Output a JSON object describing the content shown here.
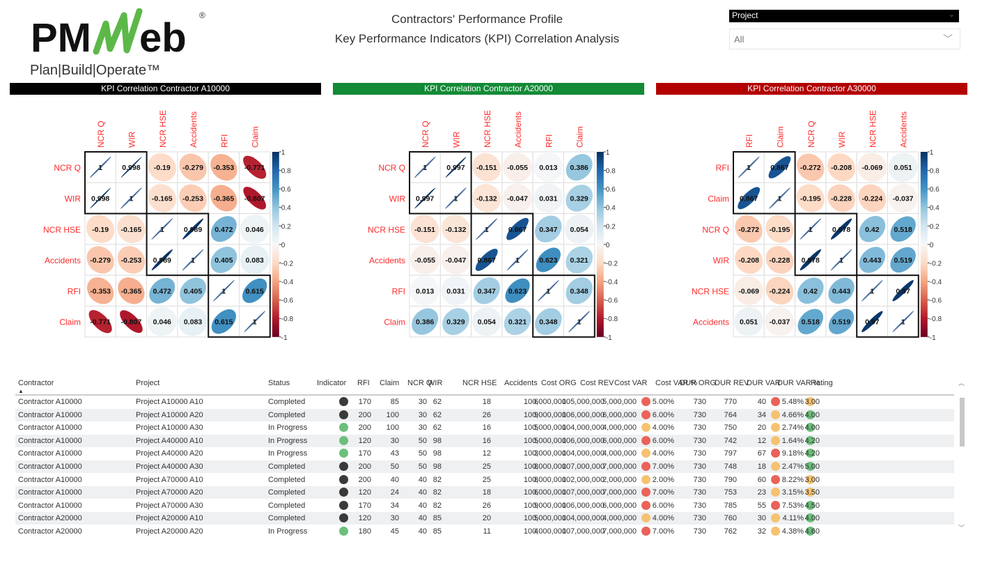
{
  "logo": {
    "text": "PMWeb",
    "tagline": "Plan|Build|Operate™",
    "registered": "®"
  },
  "header": {
    "title_line1": "Contractors' Performance Profile",
    "title_line2": "Key Performance Indicators (KPI) Correlation Analysis"
  },
  "filter": {
    "label": "Project",
    "value": "All"
  },
  "colorbar_ticks": [
    "1",
    "0.8",
    "0.6",
    "0.4",
    "0.2",
    "0",
    "-0.2",
    "-0.4",
    "-0.6",
    "-0.8",
    "-1"
  ],
  "colors": {
    "black_header": "#000000",
    "green_header": "#138a36",
    "red_header": "#b30000",
    "label_red": "#ff2b2b"
  },
  "matrices": [
    {
      "title": "KPI Correlation Contractor A10000",
      "header_color": "#000000",
      "labels": [
        "NCR Q",
        "WIR",
        "NCR HSE",
        "Accidents",
        "RFI",
        "Claim"
      ],
      "values": [
        [
          1,
          0.998,
          -0.19,
          -0.279,
          -0.353,
          -0.771
        ],
        [
          0.998,
          1,
          -0.165,
          -0.253,
          -0.365,
          -0.807
        ],
        [
          -0.19,
          -0.165,
          1,
          0.989,
          0.472,
          0.046
        ],
        [
          -0.279,
          -0.253,
          0.989,
          1,
          0.405,
          0.083
        ],
        [
          -0.353,
          -0.365,
          0.472,
          0.405,
          1,
          0.615
        ],
        [
          -0.771,
          -0.807,
          0.046,
          0.083,
          0.615,
          1
        ]
      ]
    },
    {
      "title": "KPI Correlation Contractor A20000",
      "header_color": "#138a36",
      "labels": [
        "NCR Q",
        "WIR",
        "NCR HSE",
        "Accidents",
        "RFI",
        "Claim"
      ],
      "values": [
        [
          1,
          0.997,
          -0.151,
          -0.055,
          0.013,
          0.386
        ],
        [
          0.997,
          1,
          -0.132,
          -0.047,
          0.031,
          0.329
        ],
        [
          -0.151,
          -0.132,
          1,
          0.867,
          0.347,
          0.054
        ],
        [
          -0.055,
          -0.047,
          0.867,
          1,
          0.623,
          0.321
        ],
        [
          0.013,
          0.031,
          0.347,
          0.623,
          1,
          0.348
        ],
        [
          0.386,
          0.329,
          0.054,
          0.321,
          0.348,
          1
        ]
      ]
    },
    {
      "title": "KPI Correlation Contractor A30000",
      "header_color": "#b30000",
      "labels": [
        "RFI",
        "Claim",
        "NCR Q",
        "WIR",
        "NCR HSE",
        "Accidents"
      ],
      "values": [
        [
          1,
          0.867,
          -0.272,
          -0.208,
          -0.069,
          0.051
        ],
        [
          0.867,
          1,
          -0.195,
          -0.228,
          -0.224,
          -0.037
        ],
        [
          -0.272,
          -0.195,
          1,
          0.978,
          0.42,
          0.518
        ],
        [
          -0.208,
          -0.228,
          0.978,
          1,
          0.443,
          0.519
        ],
        [
          -0.069,
          -0.224,
          0.42,
          0.443,
          1,
          0.97
        ],
        [
          0.051,
          -0.037,
          0.518,
          0.519,
          0.97,
          1
        ]
      ]
    }
  ],
  "table": {
    "columns": [
      "Contractor",
      "Project",
      "Status",
      "Indicator",
      "RFI",
      "Claim",
      "NCR Q",
      "WIR",
      "NCR HSE",
      "Accidents",
      "Cost ORG",
      "Cost REV",
      "Cost VAR",
      "Cost VAR %",
      "DUR ORG",
      "DUR REV",
      "DUR VAR",
      "DUR VAR %",
      "Rating"
    ],
    "sort_indicator": "▲",
    "rows": [
      [
        "Contractor A10000",
        "Project A10000 A10",
        "Completed",
        "dark",
        "170",
        "85",
        "30",
        "62",
        "18",
        "6",
        "100,000,000",
        "105,000,000",
        "5,000,000",
        "red",
        "5.00%",
        "730",
        "770",
        "40",
        "red",
        "5.48%",
        "orange",
        "3.00"
      ],
      [
        "Contractor A10000",
        "Project A10000 A20",
        "Completed",
        "dark",
        "200",
        "100",
        "30",
        "62",
        "26",
        "9",
        "100,000,000",
        "106,000,000",
        "6,000,000",
        "red",
        "6.00%",
        "730",
        "764",
        "34",
        "orange",
        "4.66%",
        "green",
        "4.00"
      ],
      [
        "Contractor A10000",
        "Project A10000 A30",
        "In Progress",
        "green",
        "200",
        "100",
        "30",
        "62",
        "16",
        "5",
        "100,000,000",
        "104,000,000",
        "4,000,000",
        "orange",
        "4.00%",
        "730",
        "750",
        "20",
        "orange",
        "2.74%",
        "green",
        "4.00"
      ],
      [
        "Contractor A10000",
        "Project A40000 A10",
        "In Progress",
        "green",
        "120",
        "30",
        "50",
        "98",
        "16",
        "5",
        "100,000,000",
        "106,000,000",
        "6,000,000",
        "red",
        "6.00%",
        "730",
        "742",
        "12",
        "orange",
        "1.64%",
        "green",
        "4.20"
      ],
      [
        "Contractor A10000",
        "Project A40000 A20",
        "In Progress",
        "green",
        "170",
        "43",
        "50",
        "98",
        "12",
        "3",
        "100,000,000",
        "104,000,000",
        "4,000,000",
        "orange",
        "4.00%",
        "730",
        "797",
        "67",
        "red",
        "9.18%",
        "green",
        "4.20"
      ],
      [
        "Contractor A10000",
        "Project A40000 A30",
        "Completed",
        "dark",
        "200",
        "50",
        "50",
        "98",
        "25",
        "8",
        "100,000,000",
        "107,000,000",
        "7,000,000",
        "red",
        "7.00%",
        "730",
        "748",
        "18",
        "orange",
        "2.47%",
        "green",
        "5.00"
      ],
      [
        "Contractor A10000",
        "Project A70000 A10",
        "Completed",
        "dark",
        "200",
        "40",
        "40",
        "82",
        "25",
        "8",
        "100,000,000",
        "102,000,000",
        "2,000,000",
        "orange",
        "2.00%",
        "730",
        "790",
        "60",
        "red",
        "8.22%",
        "orange",
        "3.00"
      ],
      [
        "Contractor A10000",
        "Project A70000 A20",
        "Completed",
        "dark",
        "120",
        "24",
        "40",
        "82",
        "18",
        "6",
        "100,000,000",
        "107,000,000",
        "7,000,000",
        "red",
        "7.00%",
        "730",
        "753",
        "23",
        "orange",
        "3.15%",
        "orange",
        "3.50"
      ],
      [
        "Contractor A10000",
        "Project A70000 A30",
        "Completed",
        "dark",
        "170",
        "34",
        "40",
        "82",
        "26",
        "9",
        "100,000,000",
        "106,000,000",
        "6,000,000",
        "red",
        "6.00%",
        "730",
        "785",
        "55",
        "red",
        "7.53%",
        "green",
        "4.50"
      ],
      [
        "Contractor A20000",
        "Project A20000 A10",
        "Completed",
        "dark",
        "120",
        "30",
        "40",
        "85",
        "20",
        "5",
        "100,000,000",
        "104,000,000",
        "4,000,000",
        "orange",
        "4.00%",
        "730",
        "760",
        "30",
        "orange",
        "4.11%",
        "green",
        "4.00"
      ],
      [
        "Contractor A20000",
        "Project A20000 A20",
        "In Progress",
        "green",
        "180",
        "45",
        "40",
        "85",
        "11",
        "4",
        "100,000,000",
        "107,000,000",
        "7,000,000",
        "red",
        "7.00%",
        "730",
        "762",
        "32",
        "orange",
        "4.38%",
        "green",
        "4.60"
      ]
    ]
  }
}
